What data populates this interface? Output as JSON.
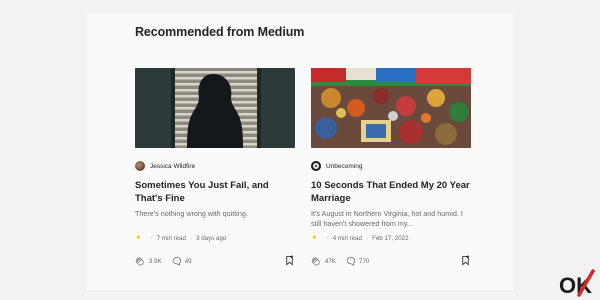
{
  "section": {
    "heading": "Recommended from Medium"
  },
  "cards": [
    {
      "author": "Jessica Wildfire",
      "title": "Sometimes You Just Fail, and That's Fine",
      "excerpt": "There's nothing wrong with quitting.",
      "read_time": "7 min read",
      "date": "3 days ago",
      "claps": "3.9K",
      "responses": "49"
    },
    {
      "author": "Unbecoming",
      "title": "10 Seconds That Ended My 20 Year Marriage",
      "excerpt": "It's August in Northern Virginia, hot and humid. I still haven't showered from my...",
      "read_time": "4 min read",
      "date": "Feb 17, 2022",
      "claps": "47K",
      "responses": "770"
    }
  ],
  "colors": {
    "member_star": "#ffc017",
    "muted_text": "#6b6b6b",
    "primary_text": "#242424"
  },
  "watermark": {
    "text": "OK"
  }
}
